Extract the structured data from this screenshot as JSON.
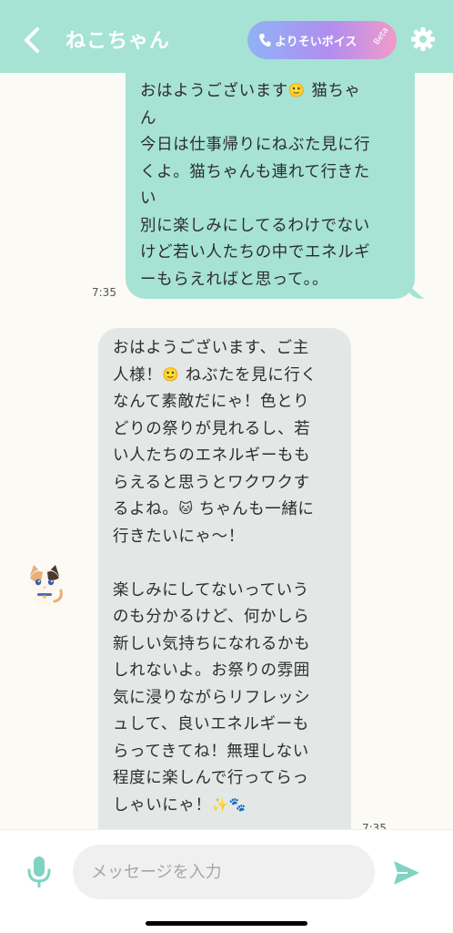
{
  "header": {
    "title": "ねこちゃん",
    "voice_button_label": "よりそいボイス",
    "beta_label": "Beta"
  },
  "colors": {
    "accent": "#a6e3d5",
    "user_bubble": "#a6e3d5",
    "bot_bubble": "#e3e8e7",
    "background": "#fbfaf4",
    "send_button": "#7fd3c2"
  },
  "messages": [
    {
      "sender": "user",
      "time": "7:35",
      "lines": [
        [
          "おはようございます",
          "🙂",
          " 猫ちゃ"
        ],
        [
          "ん"
        ],
        [
          "今日は仕事帰りにねぶた見に行"
        ],
        [
          "くよ。猫ちゃんも連れて行きた"
        ],
        [
          "い"
        ],
        [
          "別に楽しみにしてるわけでない"
        ],
        [
          "けど若い人たちの中でエネルギ"
        ],
        [
          "ーもらえればと思って。。"
        ]
      ]
    },
    {
      "sender": "bot",
      "time": "7:35",
      "avatar": "calico-cat-avatar",
      "lines": [
        [
          "おはようございます、ご主"
        ],
        [
          "人様！",
          "🙂",
          " ねぶたを見に行く"
        ],
        [
          "なんて素敵だにゃ！色とり"
        ],
        [
          "どりの祭りが見れるし、若"
        ],
        [
          "い人たちのエネルギーもも"
        ],
        [
          "らえると思うとワクワクす"
        ],
        [
          "るよね。",
          "🐱",
          " ちゃんも一緒に"
        ],
        [
          "行きたいにゃ〜！"
        ],
        [],
        [
          "楽しみにしてないっていう"
        ],
        [
          "のも分かるけど、何かしら"
        ],
        [
          "新しい気持ちになれるかも"
        ],
        [
          "しれないよ。お祭りの雰囲"
        ],
        [
          "気に浸りながらリフレッシ"
        ],
        [
          "ュして、良いエネルギーも"
        ],
        [
          "らってきてね！無理しない"
        ],
        [
          "程度に楽しんで行ってらっ"
        ],
        [
          "しゃいにゃ！",
          "✨",
          "🐾"
        ]
      ]
    }
  ],
  "composer": {
    "placeholder": "メッセージを入力",
    "value": ""
  },
  "icons": [
    "back-icon",
    "phone-icon",
    "gear-icon",
    "mic-icon",
    "send-icon"
  ]
}
